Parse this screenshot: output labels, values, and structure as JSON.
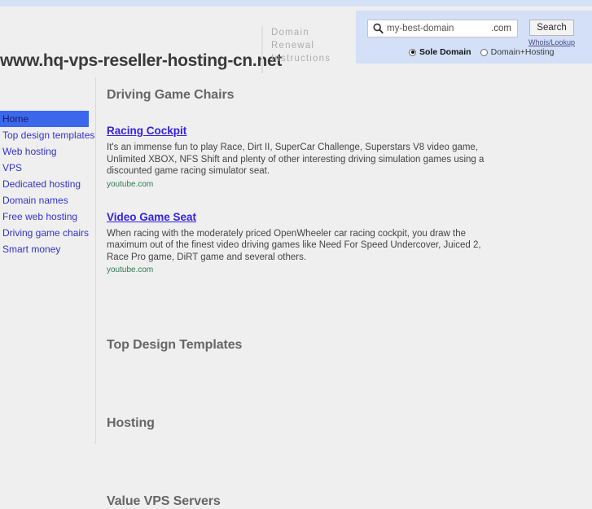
{
  "header": {
    "site_title": "www.hq-vps-reseller-hosting-cn.net",
    "renewal_lines": [
      "Domain",
      "Renewal",
      "Instructions"
    ]
  },
  "search_panel": {
    "icon": "search-icon",
    "query_value": "my-best-domain",
    "query_placeholder": "my-best-domain",
    "tld_suffix": ".com",
    "search_button_label": "Search",
    "whois_link_label": "Whois/Lookup",
    "options": [
      {
        "label": "Sole Domain",
        "selected": true
      },
      {
        "label": "Domain+Hosting",
        "selected": false
      }
    ]
  },
  "sidebar": {
    "items": [
      {
        "label": "Home",
        "active": true
      },
      {
        "label": "Top design templates",
        "active": false
      },
      {
        "label": "Web hosting",
        "active": false
      },
      {
        "label": "VPS",
        "active": false
      },
      {
        "label": "Dedicated hosting",
        "active": false
      },
      {
        "label": "Domain names",
        "active": false
      },
      {
        "label": "Free web hosting",
        "active": false
      },
      {
        "label": "Driving game chairs",
        "active": false
      },
      {
        "label": "Smart money",
        "active": false
      }
    ]
  },
  "content": {
    "sections": [
      {
        "heading": "Driving Game Chairs",
        "results": [
          {
            "title": "Racing Cockpit",
            "description": "It's an immense fun to play Race, Dirt II, SuperCar Challenge, Superstars V8 video game, Unlimited XBOX, NFS Shift and plenty of other interesting driving simulation games using a discounted game racing simulator seat.",
            "cite": "youtube.com"
          },
          {
            "title": "Video Game Seat",
            "description": "When racing with the moderately priced OpenWheeler car racing cockpit, you draw the maximum out of the finest video driving games like Need For Speed Undercover, Juiced 2, Race Pro game, DiRT game and several others.",
            "cite": "youtube.com"
          }
        ]
      },
      {
        "heading": "Top Design Templates",
        "results": []
      },
      {
        "heading": "Hosting",
        "results": []
      },
      {
        "heading": "Value VPS Servers",
        "results": []
      }
    ]
  },
  "colors": {
    "page_background": "#efefef",
    "panel_blue": "#d3e0f7",
    "top_strip_blue": "#d4e2f8",
    "link_blue": "#3322dd",
    "nav_active_blue": "#3b68ea",
    "cite_green": "#2a7a4f",
    "heading_grey": "#666666"
  }
}
